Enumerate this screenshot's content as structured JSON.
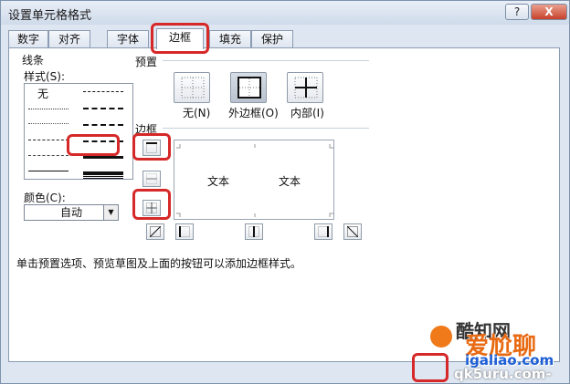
{
  "window": {
    "title": "设置单元格格式"
  },
  "titlebar": {
    "help": "?",
    "close": "X"
  },
  "tabs": [
    "数字",
    "对齐",
    "字体",
    "边框",
    "填充",
    "保护"
  ],
  "line_section": {
    "title": "线条",
    "style_label": "样式(S):",
    "none_label": "无",
    "color_label": "颜色(C):",
    "color_value": "自动"
  },
  "presets": {
    "title": "预置",
    "items": [
      {
        "label": "无(N)",
        "icon": "border-none-icon"
      },
      {
        "label": "外边框(O)",
        "icon": "border-outline-icon"
      },
      {
        "label": "内部(I)",
        "icon": "border-inside-icon"
      }
    ]
  },
  "border_section": {
    "title": "边框",
    "preview_texts": [
      "文本",
      "文本"
    ]
  },
  "hint": "单击预置选项、预览草图及上面的按钮可以添加边框样式。",
  "watermark": {
    "brand1": "爱尬聊",
    "domain1": "igaliao.com",
    "brand2": "酷知网",
    "domain2": "qk5uru.com-"
  }
}
